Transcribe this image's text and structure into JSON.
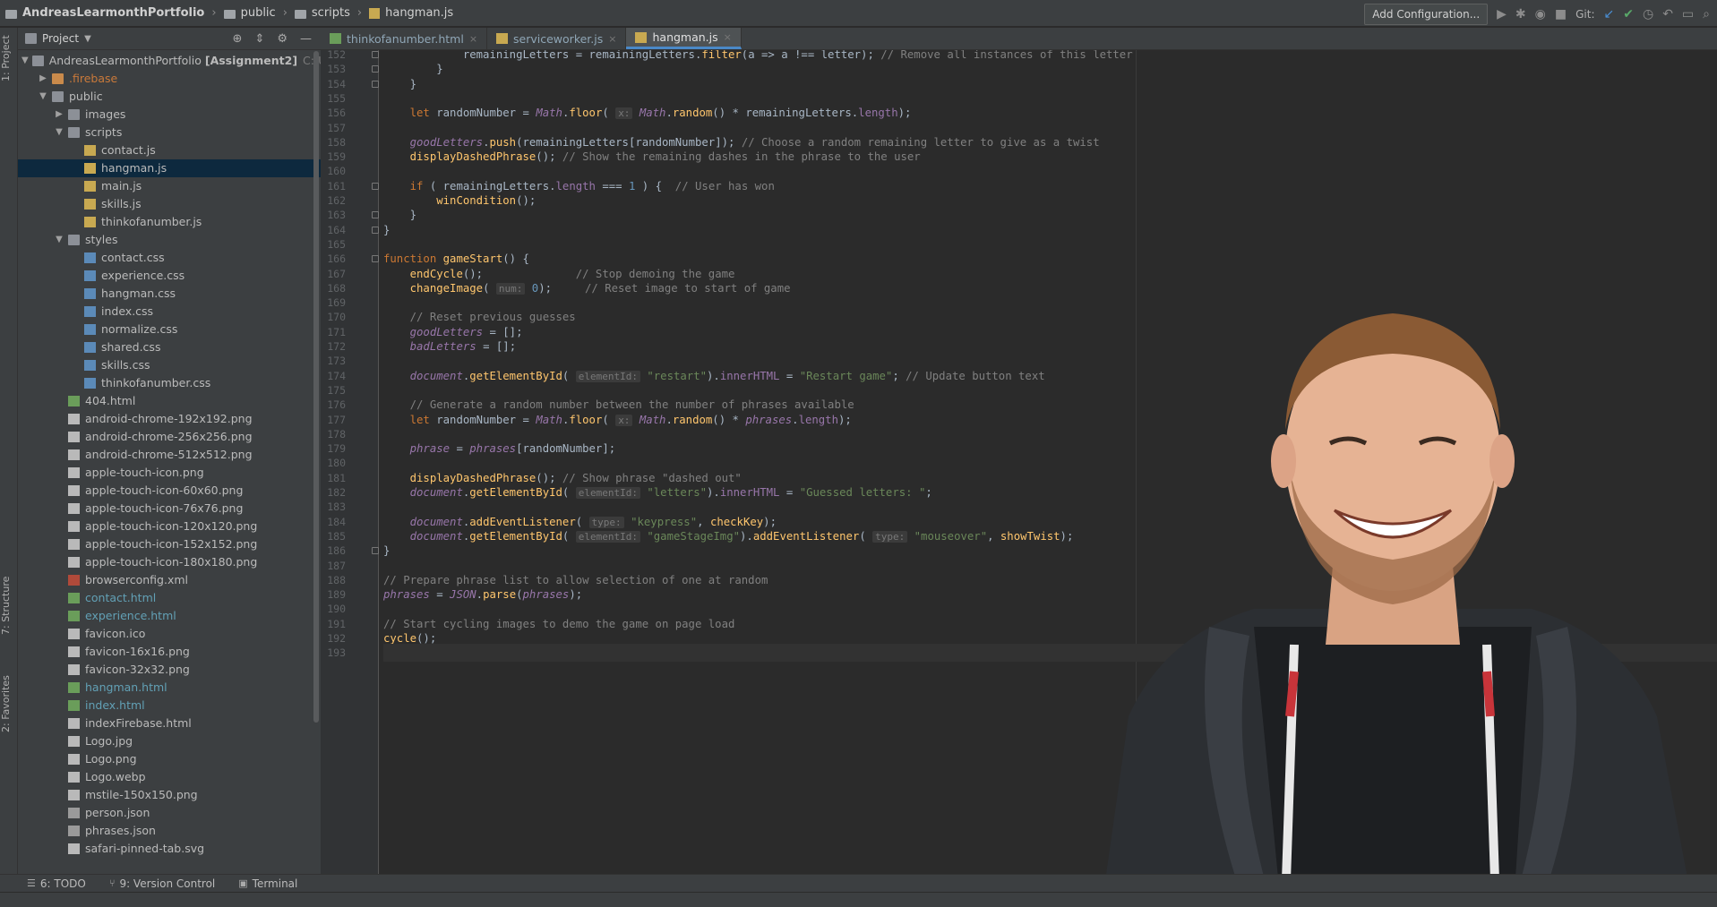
{
  "navbar": {
    "breadcrumbs": [
      "AndreasLearmonthPortfolio",
      "public",
      "scripts",
      "hangman.js"
    ],
    "add_configuration": "Add Configuration...",
    "git_label": "Git:"
  },
  "left_stripe": {
    "project_label": "1: Project",
    "structure_label": "7: Structure",
    "favorites_label": "2: Favorites"
  },
  "project_panel": {
    "title": "Project",
    "root": {
      "name": "AndreasLearmonthPortfolio",
      "module": "[Assignment2]",
      "path": "C:\\Users\\an"
    },
    "rows": [
      {
        "label": ".firebase",
        "kind": "folder-orange",
        "indent": 1,
        "arrow": "▶",
        "color": "orange"
      },
      {
        "label": "public",
        "kind": "folder",
        "indent": 1,
        "arrow": "▼"
      },
      {
        "label": "images",
        "kind": "folder",
        "indent": 2,
        "arrow": "▶"
      },
      {
        "label": "scripts",
        "kind": "folder",
        "indent": 2,
        "arrow": "▼"
      },
      {
        "label": "contact.js",
        "kind": "js",
        "indent": 3
      },
      {
        "label": "hangman.js",
        "kind": "js",
        "indent": 3,
        "selected": true
      },
      {
        "label": "main.js",
        "kind": "js",
        "indent": 3
      },
      {
        "label": "skills.js",
        "kind": "js",
        "indent": 3
      },
      {
        "label": "thinkofanumber.js",
        "kind": "js",
        "indent": 3
      },
      {
        "label": "styles",
        "kind": "folder",
        "indent": 2,
        "arrow": "▼"
      },
      {
        "label": "contact.css",
        "kind": "css",
        "indent": 3
      },
      {
        "label": "experience.css",
        "kind": "css",
        "indent": 3
      },
      {
        "label": "hangman.css",
        "kind": "css",
        "indent": 3
      },
      {
        "label": "index.css",
        "kind": "css",
        "indent": 3
      },
      {
        "label": "normalize.css",
        "kind": "css",
        "indent": 3
      },
      {
        "label": "shared.css",
        "kind": "css",
        "indent": 3
      },
      {
        "label": "skills.css",
        "kind": "css",
        "indent": 3
      },
      {
        "label": "thinkofanumber.css",
        "kind": "css",
        "indent": 3
      },
      {
        "label": "404.html",
        "kind": "html",
        "indent": 2
      },
      {
        "label": "android-chrome-192x192.png",
        "kind": "img",
        "indent": 2
      },
      {
        "label": "android-chrome-256x256.png",
        "kind": "img",
        "indent": 2
      },
      {
        "label": "android-chrome-512x512.png",
        "kind": "img",
        "indent": 2
      },
      {
        "label": "apple-touch-icon.png",
        "kind": "img",
        "indent": 2
      },
      {
        "label": "apple-touch-icon-60x60.png",
        "kind": "img",
        "indent": 2
      },
      {
        "label": "apple-touch-icon-76x76.png",
        "kind": "img",
        "indent": 2
      },
      {
        "label": "apple-touch-icon-120x120.png",
        "kind": "img",
        "indent": 2
      },
      {
        "label": "apple-touch-icon-152x152.png",
        "kind": "img",
        "indent": 2
      },
      {
        "label": "apple-touch-icon-180x180.png",
        "kind": "img",
        "indent": 2
      },
      {
        "label": "browserconfig.xml",
        "kind": "xml",
        "indent": 2
      },
      {
        "label": "contact.html",
        "kind": "html",
        "indent": 2,
        "color": "green"
      },
      {
        "label": "experience.html",
        "kind": "html",
        "indent": 2,
        "color": "green"
      },
      {
        "label": "favicon.ico",
        "kind": "img",
        "indent": 2
      },
      {
        "label": "favicon-16x16.png",
        "kind": "img",
        "indent": 2
      },
      {
        "label": "favicon-32x32.png",
        "kind": "img",
        "indent": 2
      },
      {
        "label": "hangman.html",
        "kind": "html",
        "indent": 2,
        "color": "green"
      },
      {
        "label": "index.html",
        "kind": "html",
        "indent": 2,
        "color": "green"
      },
      {
        "label": "indexFirebase.html",
        "kind": "img",
        "indent": 2
      },
      {
        "label": "Logo.jpg",
        "kind": "img",
        "indent": 2
      },
      {
        "label": "Logo.png",
        "kind": "img",
        "indent": 2
      },
      {
        "label": "Logo.webp",
        "kind": "img",
        "indent": 2
      },
      {
        "label": "mstile-150x150.png",
        "kind": "img",
        "indent": 2
      },
      {
        "label": "person.json",
        "kind": "json",
        "indent": 2
      },
      {
        "label": "phrases.json",
        "kind": "json",
        "indent": 2
      },
      {
        "label": "safari-pinned-tab.svg",
        "kind": "img",
        "indent": 2
      }
    ]
  },
  "tabs": [
    {
      "label": "thinkofanumber.html",
      "kind": "html",
      "active": false
    },
    {
      "label": "serviceworker.js",
      "kind": "js",
      "active": false
    },
    {
      "label": "hangman.js",
      "kind": "js",
      "active": true
    }
  ],
  "editor": {
    "first_line": 152,
    "current_line": 193,
    "lines": [
      [
        [
          "",
          "            "
        ],
        [
          "",
          "remainingLetters = remainingLetters."
        ],
        [
          "fn",
          "filter"
        ],
        [
          "",
          "(a => a !== letter); "
        ],
        [
          "cm",
          "// Remove all instances of this letter"
        ]
      ],
      [
        [
          "",
          "        }"
        ]
      ],
      [
        [
          "",
          "    }"
        ]
      ],
      [],
      [
        [
          "",
          "    "
        ],
        [
          "kw",
          "let "
        ],
        [
          "",
          "randomNumber = "
        ],
        [
          "gv",
          "Math"
        ],
        [
          "",
          "."
        ],
        [
          "fn",
          "floor"
        ],
        [
          "",
          "( "
        ],
        [
          "hint-tag",
          "x:"
        ],
        [
          "",
          " "
        ],
        [
          "gv",
          "Math"
        ],
        [
          "",
          "."
        ],
        [
          "fn",
          "random"
        ],
        [
          "",
          "() * remainingLetters."
        ],
        [
          "prop",
          "length"
        ],
        [
          "",
          ");"
        ]
      ],
      [],
      [
        [
          "",
          "    "
        ],
        [
          "ic",
          "goodLetters"
        ],
        [
          "",
          "."
        ],
        [
          "fn",
          "push"
        ],
        [
          "",
          "(remainingLetters[randomNumber]); "
        ],
        [
          "cm",
          "// Choose a random remaining letter to give as a twist"
        ]
      ],
      [
        [
          "",
          "    "
        ],
        [
          "fn",
          "displayDashedPhrase"
        ],
        [
          "",
          "(); "
        ],
        [
          "cm",
          "// Show the remaining dashes in the phrase to the user"
        ]
      ],
      [],
      [
        [
          "",
          "    "
        ],
        [
          "kw",
          "if "
        ],
        [
          "",
          "( remainingLetters."
        ],
        [
          "prop",
          "length"
        ],
        [
          "",
          " === "
        ],
        [
          "num",
          "1"
        ],
        [
          "",
          " ) {  "
        ],
        [
          "cm",
          "// User has won"
        ]
      ],
      [
        [
          "",
          "        "
        ],
        [
          "fn",
          "winCondition"
        ],
        [
          "",
          "();"
        ]
      ],
      [
        [
          "",
          "    }"
        ]
      ],
      [
        [
          "",
          "}"
        ]
      ],
      [],
      [
        [
          "kw",
          "function "
        ],
        [
          "fn",
          "gameStart"
        ],
        [
          "",
          "() {"
        ]
      ],
      [
        [
          "",
          "    "
        ],
        [
          "fn",
          "endCycle"
        ],
        [
          "",
          "();              "
        ],
        [
          "cm",
          "// Stop demoing the game"
        ]
      ],
      [
        [
          "",
          "    "
        ],
        [
          "fn",
          "changeImage"
        ],
        [
          "",
          "( "
        ],
        [
          "hint-tag",
          "num:"
        ],
        [
          "",
          " "
        ],
        [
          "num",
          "0"
        ],
        [
          "",
          ");     "
        ],
        [
          "cm",
          "// Reset image to start of game"
        ]
      ],
      [],
      [
        [
          "",
          "    "
        ],
        [
          "cm",
          "// Reset previous guesses"
        ]
      ],
      [
        [
          "",
          "    "
        ],
        [
          "ic",
          "goodLetters"
        ],
        [
          "",
          " = [];"
        ]
      ],
      [
        [
          "",
          "    "
        ],
        [
          "ic",
          "badLetters"
        ],
        [
          "",
          " = [];"
        ]
      ],
      [],
      [
        [
          "",
          "    "
        ],
        [
          "ic",
          "document"
        ],
        [
          "",
          "."
        ],
        [
          "fn",
          "getElementById"
        ],
        [
          "",
          "( "
        ],
        [
          "hint-tag",
          "elementId:"
        ],
        [
          "",
          " "
        ],
        [
          "str",
          "\"restart\""
        ],
        [
          "",
          ")."
        ],
        [
          "prop",
          "innerHTML"
        ],
        [
          "",
          " = "
        ],
        [
          "str",
          "\"Restart game\""
        ],
        [
          "",
          "; "
        ],
        [
          "cm",
          "// Update button text"
        ]
      ],
      [],
      [
        [
          "",
          "    "
        ],
        [
          "cm",
          "// Generate a random number between the number of phrases available"
        ]
      ],
      [
        [
          "",
          "    "
        ],
        [
          "kw",
          "let "
        ],
        [
          "",
          "randomNumber = "
        ],
        [
          "gv",
          "Math"
        ],
        [
          "",
          "."
        ],
        [
          "fn",
          "floor"
        ],
        [
          "",
          "( "
        ],
        [
          "hint-tag",
          "x:"
        ],
        [
          "",
          " "
        ],
        [
          "gv",
          "Math"
        ],
        [
          "",
          "."
        ],
        [
          "fn",
          "random"
        ],
        [
          "",
          "() * "
        ],
        [
          "ic",
          "phrases"
        ],
        [
          "",
          "."
        ],
        [
          "prop",
          "length"
        ],
        [
          "",
          ");"
        ]
      ],
      [],
      [
        [
          "",
          "    "
        ],
        [
          "ic",
          "phrase"
        ],
        [
          "",
          " = "
        ],
        [
          "ic",
          "phrases"
        ],
        [
          "",
          "[randomNumber];"
        ]
      ],
      [],
      [
        [
          "",
          "    "
        ],
        [
          "fn",
          "displayDashedPhrase"
        ],
        [
          "",
          "(); "
        ],
        [
          "cm",
          "// Show phrase \"dashed out\""
        ]
      ],
      [
        [
          "",
          "    "
        ],
        [
          "ic",
          "document"
        ],
        [
          "",
          "."
        ],
        [
          "fn",
          "getElementById"
        ],
        [
          "",
          "( "
        ],
        [
          "hint-tag",
          "elementId:"
        ],
        [
          "",
          " "
        ],
        [
          "str",
          "\"letters\""
        ],
        [
          "",
          ")."
        ],
        [
          "prop",
          "innerHTML"
        ],
        [
          "",
          " = "
        ],
        [
          "str",
          "\"Guessed letters: \""
        ],
        [
          "",
          ";"
        ]
      ],
      [],
      [
        [
          "",
          "    "
        ],
        [
          "ic",
          "document"
        ],
        [
          "",
          "."
        ],
        [
          "fn",
          "addEventListener"
        ],
        [
          "",
          "( "
        ],
        [
          "hint-tag",
          "type:"
        ],
        [
          "",
          " "
        ],
        [
          "str",
          "\"keypress\""
        ],
        [
          "",
          ", "
        ],
        [
          "fn",
          "checkKey"
        ],
        [
          "",
          ");"
        ]
      ],
      [
        [
          "",
          "    "
        ],
        [
          "ic",
          "document"
        ],
        [
          "",
          "."
        ],
        [
          "fn",
          "getElementById"
        ],
        [
          "",
          "( "
        ],
        [
          "hint-tag",
          "elementId:"
        ],
        [
          "",
          " "
        ],
        [
          "str",
          "\"gameStageImg\""
        ],
        [
          "",
          ")."
        ],
        [
          "fn",
          "addEventListener"
        ],
        [
          "",
          "( "
        ],
        [
          "hint-tag",
          "type:"
        ],
        [
          "",
          " "
        ],
        [
          "str",
          "\"mouseover\""
        ],
        [
          "",
          ", "
        ],
        [
          "fn",
          "showTwist"
        ],
        [
          "",
          ");"
        ]
      ],
      [
        [
          "",
          "}"
        ]
      ],
      [],
      [
        [
          "cm",
          "// Prepare phrase list to allow selection of one at random"
        ]
      ],
      [
        [
          "ic",
          "phrases"
        ],
        [
          "",
          " = "
        ],
        [
          "gv",
          "JSON"
        ],
        [
          "",
          "."
        ],
        [
          "fn",
          "parse"
        ],
        [
          "",
          "("
        ],
        [
          "ic",
          "phrases"
        ],
        [
          "",
          ");"
        ]
      ],
      [],
      [
        [
          "cm",
          "// Start cycling images to demo the game on page load"
        ]
      ],
      [
        [
          "fn",
          "cycle"
        ],
        [
          "",
          "();"
        ]
      ],
      []
    ]
  },
  "bottom_bar": {
    "todo": "6: TODO",
    "version_control": "9: Version Control",
    "terminal": "Terminal"
  },
  "colors": {
    "accent": "#4a88c7",
    "selection": "#0d293e",
    "editor_bg": "#2b2b2b",
    "panel_bg": "#3c3f41"
  }
}
